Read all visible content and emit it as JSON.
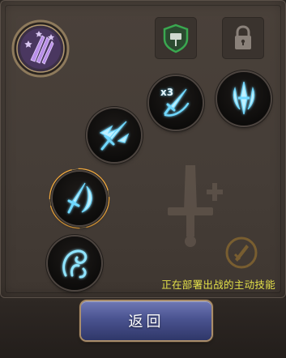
{
  "panel": {
    "hero_emblem_icon": "purple-claw-emblem-icon",
    "guard_slot_icon": "shield-flag-icon",
    "locked_slot_icon": "lock-icon"
  },
  "skills": [
    {
      "icon": "triple-slash-icon",
      "badge": "x3",
      "selected": false
    },
    {
      "icon": "piercing-blades-icon",
      "badge": "",
      "selected": false
    },
    {
      "icon": "winged-sword-icon",
      "badge": "",
      "selected": false
    },
    {
      "icon": "crescent-sword-icon",
      "badge": "",
      "selected": true
    },
    {
      "icon": "wind-swirl-icon",
      "badge": "",
      "selected": false
    }
  ],
  "background_decor": {
    "sword_icon": "sword-silhouette-icon",
    "medal_icon": "sword-medal-icon"
  },
  "status": {
    "text": "正在部署出战的主动技能"
  },
  "footer": {
    "back_label": "返回"
  },
  "colors": {
    "skill_glow": "#6fd8ff",
    "status_text": "#e3e049",
    "button_blue": "#4a5390",
    "selected_ring": "#f0a030",
    "shield_green": "#3aa850",
    "emblem_purple": "#8a5cc8"
  }
}
